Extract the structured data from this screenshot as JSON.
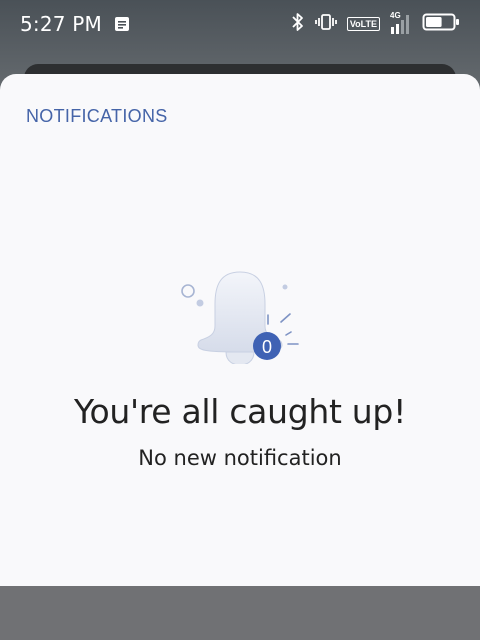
{
  "status_bar": {
    "time": "5:27 PM",
    "volte_label": "VoLTE",
    "network_label": "4G",
    "icons": [
      "notes-icon",
      "bluetooth-icon",
      "vibrate-icon",
      "volte-icon",
      "signal-icon",
      "battery-icon"
    ],
    "battery_level": 0.6
  },
  "sheet": {
    "title": "NOTIFICATIONS",
    "badge_count": "0",
    "headline": "You're all caught up!",
    "subline": "No new notification"
  },
  "colors": {
    "accent": "#4564a8",
    "sheet_background": "#f9f9fb",
    "badge": "#3f62b4",
    "bell": "#dfe3ee"
  }
}
